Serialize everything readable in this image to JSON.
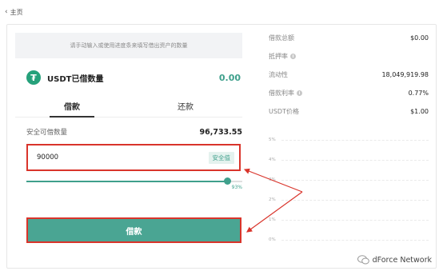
{
  "nav": {
    "back_label": "主页"
  },
  "hint_text": "请手动输入或使用进度条来填写借出资产的数量",
  "asset": {
    "icon": "tether-icon",
    "title": "USDT已借数量",
    "amount": "0.00"
  },
  "tabs": [
    {
      "label": "借款",
      "active": true
    },
    {
      "label": "还款",
      "active": false
    }
  ],
  "safe_borrow": {
    "label": "安全可借数量",
    "value": "96,733.55"
  },
  "input": {
    "value": "90000",
    "tag": "安全值"
  },
  "slider": {
    "percent_label": "93%",
    "fraction": 0.93
  },
  "borrow_button": {
    "label": "借款"
  },
  "stats": [
    {
      "label": "借款总额",
      "value": "$0.00",
      "info": false
    },
    {
      "label": "抵押率",
      "value": "",
      "info": true
    },
    {
      "label": "流动性",
      "value": "18,049,919.98",
      "info": false
    },
    {
      "label": "借款利率",
      "value": "0.77%",
      "info": true
    },
    {
      "label": "USDT价格",
      "value": "$1.00",
      "info": false
    }
  ],
  "chart_axis": [
    "5%",
    "4%",
    "3%",
    "2%",
    "1%",
    "0%"
  ],
  "watermark": {
    "text": "dForce Network",
    "icon": "wechat-icon"
  },
  "colors": {
    "accent": "#3fa08c",
    "button": "#4aa593",
    "highlight": "#d9342b"
  }
}
